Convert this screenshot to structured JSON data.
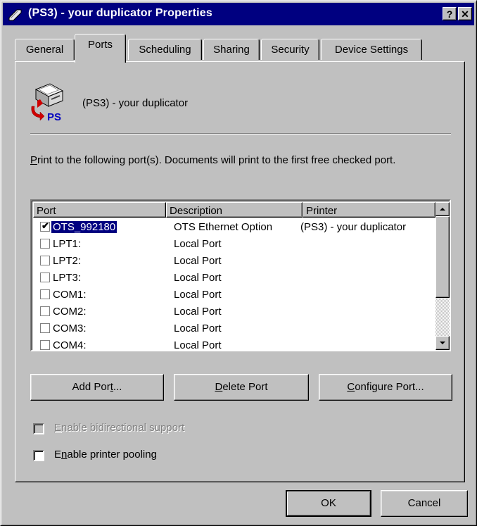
{
  "window": {
    "title": "(PS3) - your duplicator Properties",
    "help_label": "?",
    "close_label": "✕"
  },
  "tabs": [
    {
      "label": "General"
    },
    {
      "label": "Ports"
    },
    {
      "label": "Scheduling"
    },
    {
      "label": "Sharing"
    },
    {
      "label": "Security"
    },
    {
      "label": "Device Settings"
    }
  ],
  "printer": {
    "name": "(PS3) - your duplicator",
    "icon_badge": "PS"
  },
  "instructions": {
    "mnemonic": "P",
    "text": "rint to the following port(s).  Documents will print to the first free checked port."
  },
  "port_list": {
    "columns": {
      "port": "Port",
      "description": "Description",
      "printer": "Printer"
    },
    "rows": [
      {
        "port": "OTS_992180",
        "description": "OTS Ethernet Option",
        "printer": "(PS3) - your duplicator",
        "checked": "✔"
      },
      {
        "port": "LPT1:",
        "description": "Local Port",
        "printer": "",
        "checked": ""
      },
      {
        "port": "LPT2:",
        "description": "Local Port",
        "printer": "",
        "checked": ""
      },
      {
        "port": "LPT3:",
        "description": "Local Port",
        "printer": "",
        "checked": ""
      },
      {
        "port": "COM1:",
        "description": "Local Port",
        "printer": "",
        "checked": ""
      },
      {
        "port": "COM2:",
        "description": "Local Port",
        "printer": "",
        "checked": ""
      },
      {
        "port": "COM3:",
        "description": "Local Port",
        "printer": "",
        "checked": ""
      },
      {
        "port": "COM4:",
        "description": "Local Port",
        "printer": "",
        "checked": ""
      }
    ]
  },
  "buttons": {
    "add_port": {
      "before": "Add Por",
      "mnemonic": "t",
      "after": "..."
    },
    "delete_port": {
      "before": "",
      "mnemonic": "D",
      "after": "elete Port"
    },
    "configure_port": {
      "before": "",
      "mnemonic": "C",
      "after": "onfigure Port..."
    },
    "ok": "OK",
    "cancel": "Cancel"
  },
  "options": {
    "bidirectional": {
      "mnemonic": "E",
      "rest": "nable bidirectional support",
      "checked": false,
      "enabled": false
    },
    "pooling": {
      "before": "E",
      "mnemonic": "n",
      "rest": "able printer pooling",
      "checked": false,
      "enabled": true
    }
  }
}
